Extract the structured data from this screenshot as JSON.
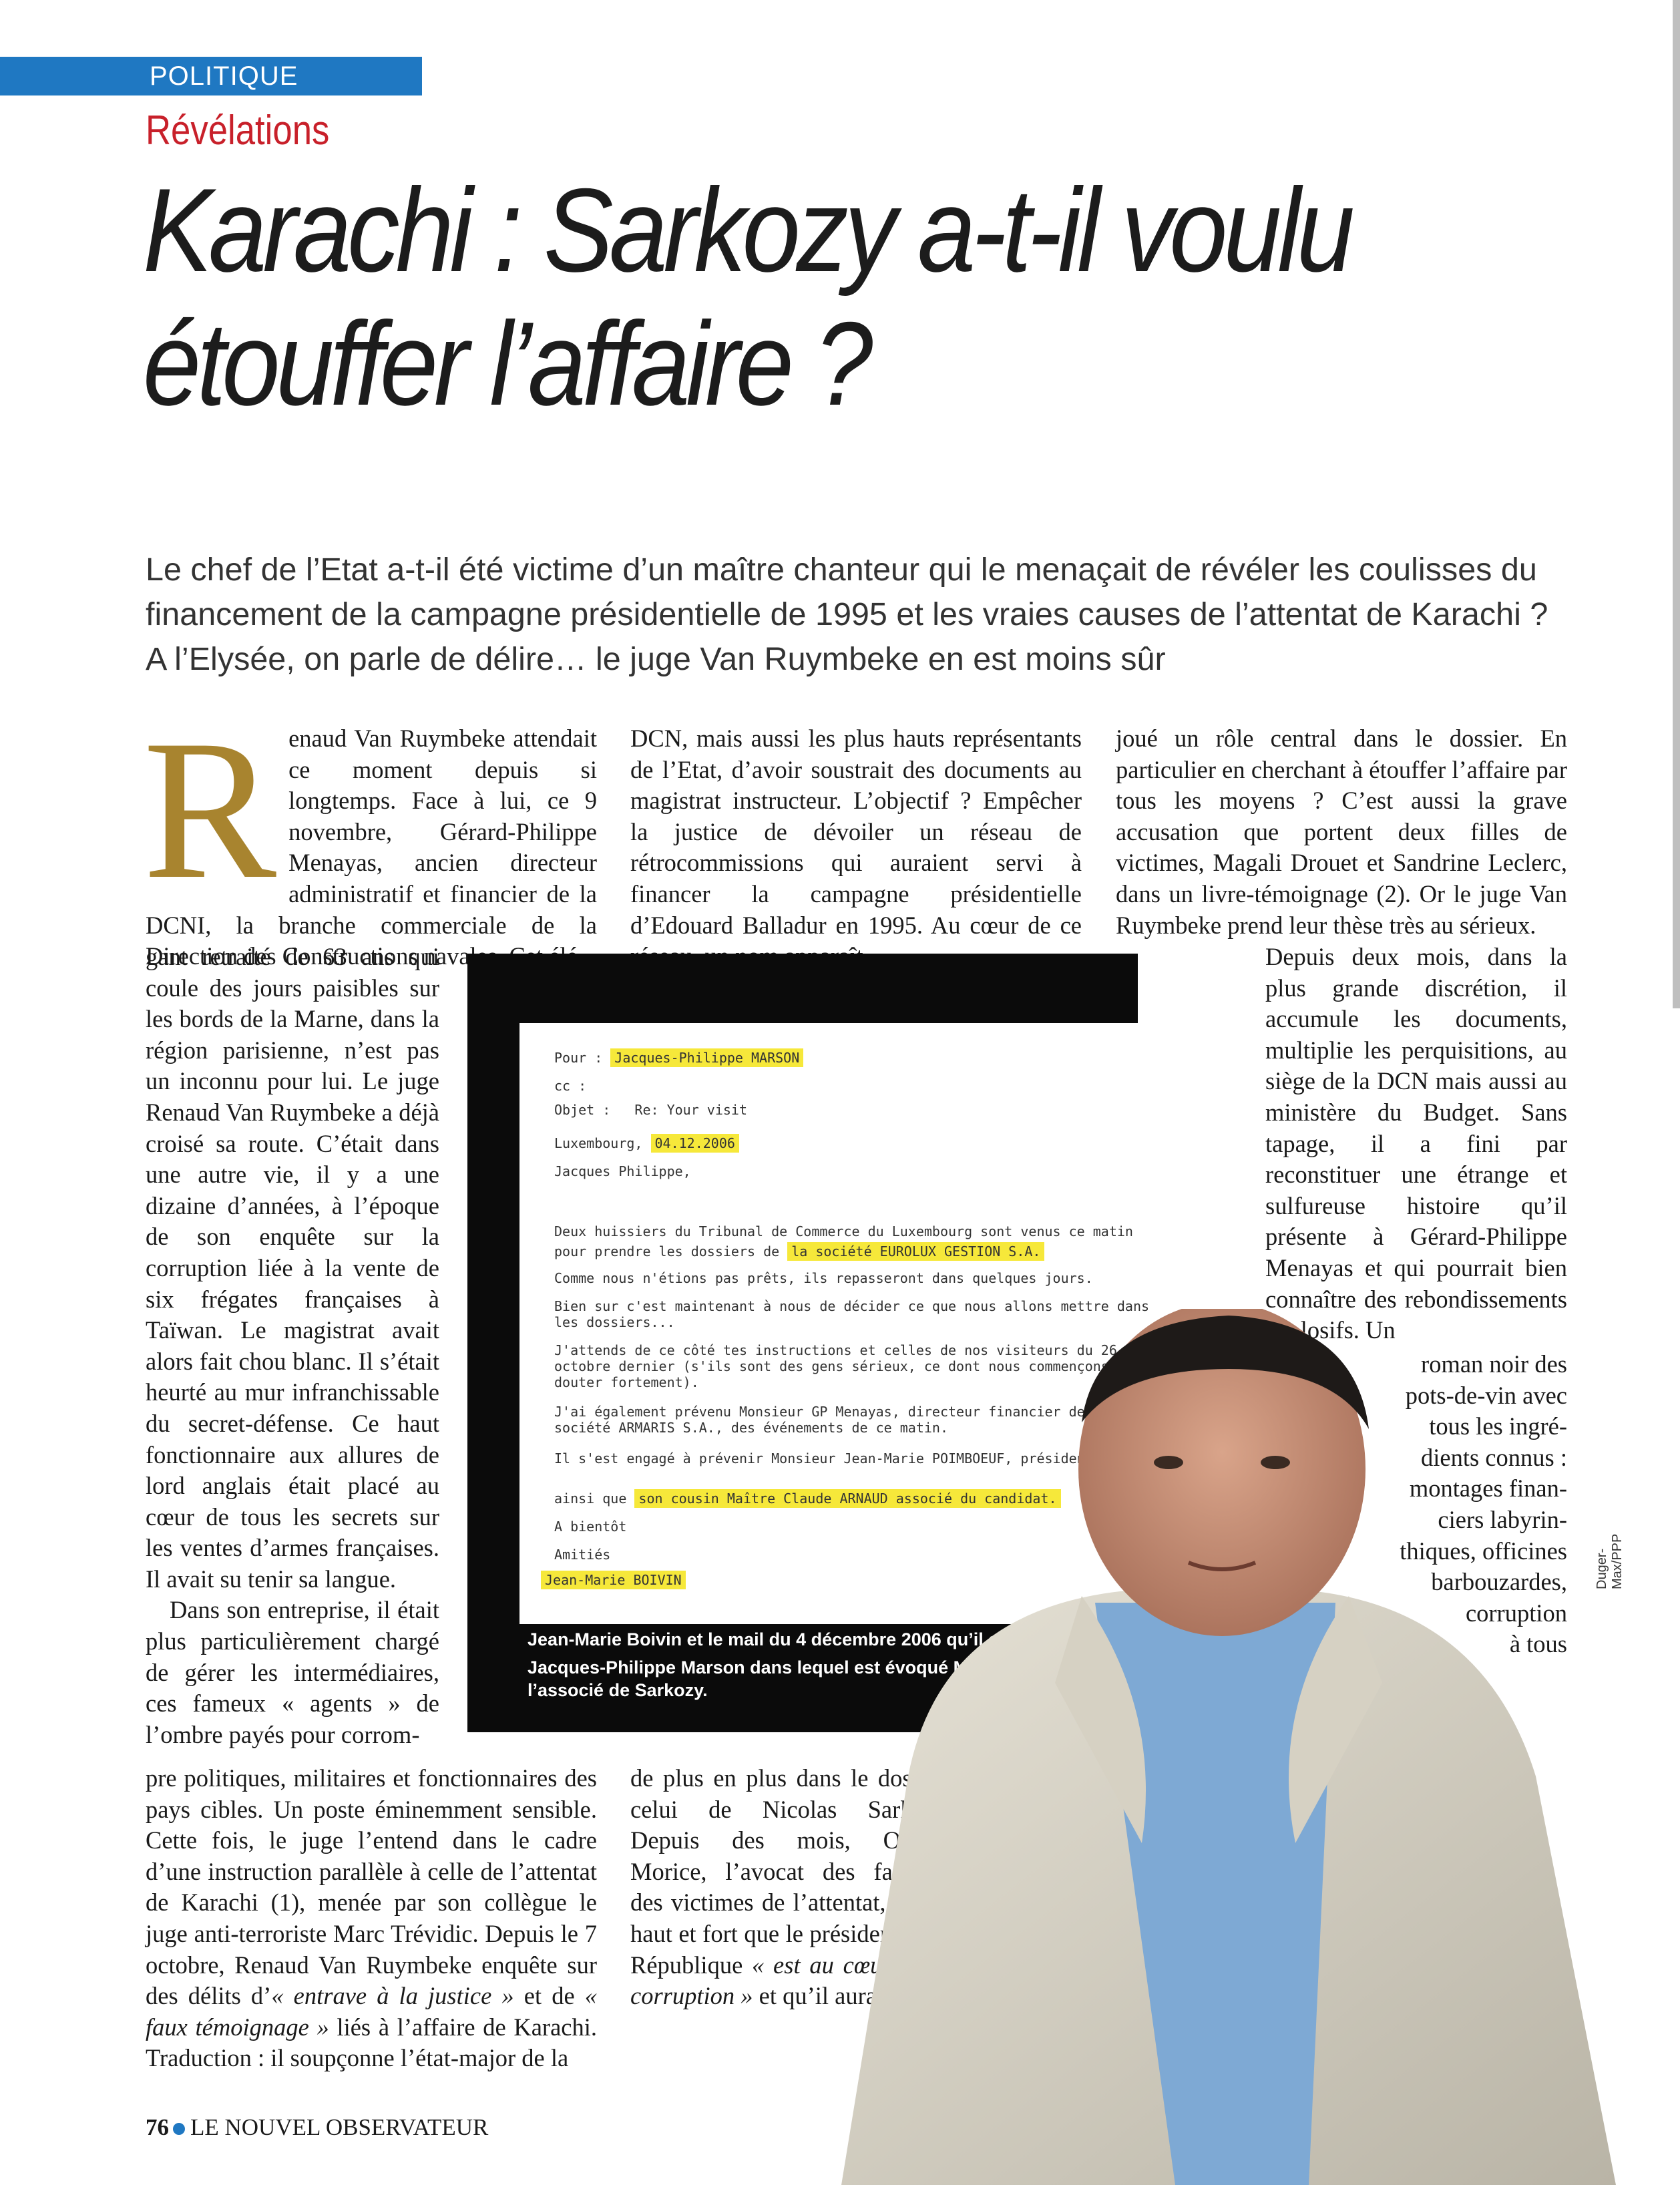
{
  "rubric": "POLITIQUE",
  "kicker": "Révélations",
  "headline": {
    "line1": "Karachi : Sarkozy a-t-il voulu",
    "line2": "étouffer l’affaire ?"
  },
  "chapo": "Le chef de l’Etat a-t-il été victime d’un maître chanteur qui le menaçait de révéler les coulisses du financement de la campagne présidentielle de 1995 et les vraies causes de l’attentat de Karachi ? A l’Elysée, on parle de délire… le juge Van Ruymbeke en est moins sûr",
  "col1": {
    "dropcap": "R",
    "p1_top": "enaud Van Ruymbeke attendait ce moment depuis si longtemps. Face à lui, ce 9 novembre, Gérard-Philippe Menayas, ancien directeur administratif et financier de la DCNI, la branche commerciale de la Direction des Constructions navales. Cet élé-",
    "p1_narrow": "gant retraité de 63 ans qui coule des jours paisibles sur les bords de la Marne, dans la région parisienne, n’est pas un inconnu pour lui. Le juge Renaud Van Ruymbeke a déjà croisé sa route. C’était dans une autre vie, il y a une dizaine d’années, à l’époque de son enquête sur la corruption liée à la vente de six frégates françaises à Taïwan. Le magistrat avait alors fait chou blanc. Il s’était heurté au mur infranchissable du secret-défense. Ce haut fonctionnaire aux allures de lord anglais était placé au cœur de tous les secrets sur les ventes d’armes françaises. Il avait su tenir sa langue.",
    "p2_narrow": "Dans son entreprise, il était plus particulièrement chargé de gérer les intermédiaires, ces fameux « agents » de l’ombre payés pour corrom-",
    "p2_bottom": "pre politiques, militaires et fonctionnaires des pays cibles. Un poste éminemment sensible. Cette fois, le juge l’entend dans le cadre d’une instruction parallèle à celle de l’attentat de Karachi (1), menée par son collègue le juge anti-terroriste Marc Trévidic. Depuis le 7 octobre, Renaud Van Ruymbeke enquête sur des délits d’",
    "p2_it1": "« entrave à la justice »",
    "p2_mid": " et de ",
    "p2_it2": "« faux témoignage »",
    "p2_end": " liés à l’affaire de Karachi. Traduction : il soupçonne l’état-major de la"
  },
  "col2": {
    "top": "DCN, mais aussi les plus hauts représentants de l’Etat, d’avoir soustrait des documents au magistrat instructeur. L’objectif ? Empêcher la justice de dévoiler un réseau de rétrocommissions qui auraient servi à financer la campagne présidentielle d’Edouard Balladur en 1995. Au cœur de ce réseau, un nom apparaît",
    "bottom_start": "de plus en plus dans le dossier, celui de Nicolas Sarkozy. Depuis des mois, Olivier Morice, l’avocat des familles des victimes de l’attentat, clame haut et fort que le président de la République ",
    "bottom_it": "« est au cœur de la corruption »",
    "bottom_end": " et qu’il aurait"
  },
  "col3": {
    "top": "joué un rôle central dans le dossier. En particulier en cherchant à étouffer l’affaire par tous les moyens ? C’est aussi la grave accusation que portent deux filles de victimes, Magali Drouet et Sandrine Leclerc, dans un livre-témoignage (2). Or le juge Van Ruymbeke prend leur thèse très au sérieux.",
    "narrow": "Depuis deux mois, dans la plus grande discrétion, il accumule les documents, multiplie les perquisitions, au siège de la DCN mais aussi au ministère du Budget. Sans tapage, il a fini par reconstituer une étrange et sulfureuse histoire qu’il présente à Gérard-Philippe Menayas et qui pourrait bien connaître des rebondissements explosifs. Un",
    "wrap": [
      "roman noir des",
      "pots-de-vin avec",
      "tous les ingré-",
      "dients connus :",
      "montages finan-",
      "ciers labyrin-",
      "thiques, officines",
      "barbouzardes,",
      "corruption",
      "à tous"
    ]
  },
  "memo": {
    "pour_label": "Pour :",
    "pour_value": "Jacques-Philippe MARSON",
    "cc_label": "cc :",
    "objet_label": "Objet :",
    "objet_value": "Re: Your visit",
    "city": "Luxembourg,",
    "date": "04.12.2006",
    "greeting": "Jacques Philippe,",
    "l1": "Deux huissiers du Tribunal de Commerce du Luxembourg sont venus ce matin",
    "l2a": "pour prendre les dossiers de",
    "l2b": "la société EUROLUX GESTION S.A.",
    "l3": "Comme nous n'étions pas prêts, ils repasseront dans quelques jours.",
    "l4": "Bien sur c'est maintenant à nous de décider ce que nous allons mettre dans",
    "l5": "les dossiers...",
    "l6": "J'attends de ce côté tes instructions et celles de nos visiteurs du 26",
    "l7": "octobre dernier (s'ils sont des gens sérieux, ce dont nous commençons à",
    "l8": "douter fortement).",
    "l9": "J'ai également prévenu Monsieur GP Menayas, directeur financier de la",
    "l10": "société ARMARIS S.A., des événements de ce matin.",
    "l11": "Il s'est engagé à prévenir Monsieur Jean-Marie POIMBOEUF, président de DCN",
    "l12a": "ainsi que",
    "l12b": "son cousin Maître Claude ARNAUD associé du candidat.",
    "l13": "A bientôt",
    "l14": "Amitiés",
    "sign": "Jean-Marie BOIVIN"
  },
  "caption": {
    "text1": "Jean-Marie Boivin et le mail du 4 décembre 2006 qu’il a envoyé à Jacques-Philippe Marson dans lequel est évoqué M",
    "sup": "e",
    "text2": " Arnaud Claude, l’associé de Sarkozy."
  },
  "photo_credit": "Duger-Max/PPP",
  "folio": {
    "page": "76",
    "magazine": "LE NOUVEL OBSERVATEUR"
  }
}
